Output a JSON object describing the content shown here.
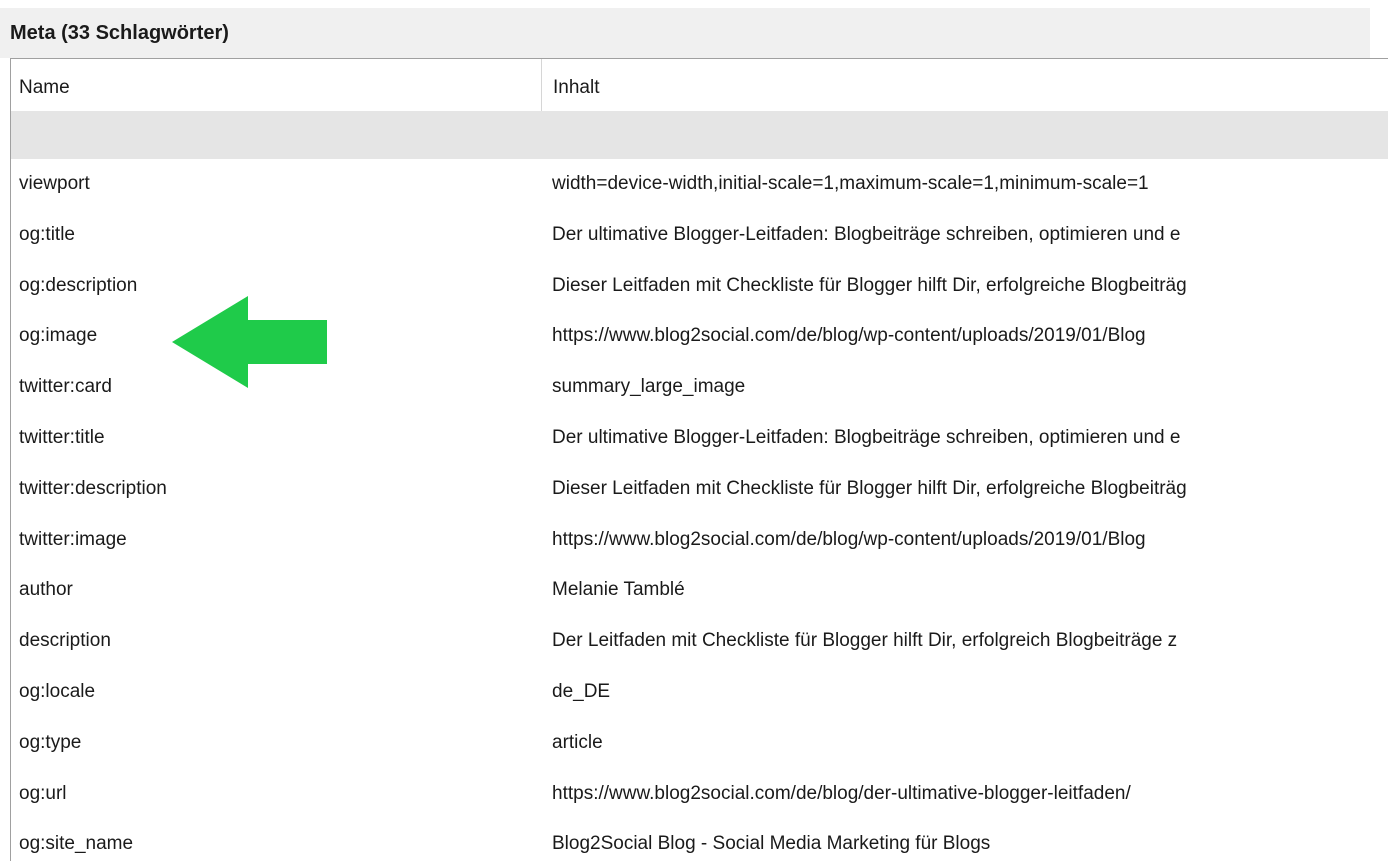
{
  "panel": {
    "title": "Meta (33 Schlagwörter)"
  },
  "table": {
    "columns": [
      "Name",
      "Inhalt"
    ],
    "rows": [
      {
        "name": "viewport",
        "content": "width=device-width,initial-scale=1,maximum-scale=1,minimum-scale=1"
      },
      {
        "name": "og:title",
        "content": "Der ultimative Blogger-Leitfaden: Blogbeiträge schreiben, optimieren und e"
      },
      {
        "name": "og:description",
        "content": "Dieser Leitfaden mit Checkliste für Blogger hilft Dir, erfolgreiche Blogbeiträg"
      },
      {
        "name": "og:image",
        "content": "https://www.blog2social.com/de/blog/wp-content/uploads/2019/01/Blog"
      },
      {
        "name": "twitter:card",
        "content": "summary_large_image"
      },
      {
        "name": "twitter:title",
        "content": "Der ultimative Blogger-Leitfaden: Blogbeiträge schreiben, optimieren und e"
      },
      {
        "name": "twitter:description",
        "content": "Dieser Leitfaden mit Checkliste für Blogger hilft Dir, erfolgreiche Blogbeiträg"
      },
      {
        "name": "twitter:image",
        "content": "https://www.blog2social.com/de/blog/wp-content/uploads/2019/01/Blog"
      },
      {
        "name": "author",
        "content": "Melanie Tamblé"
      },
      {
        "name": "description",
        "content": "Der Leitfaden mit Checkliste für Blogger hilft Dir, erfolgreich Blogbeiträge z"
      },
      {
        "name": "og:locale",
        "content": "de_DE"
      },
      {
        "name": "og:type",
        "content": "article"
      },
      {
        "name": "og:url",
        "content": "https://www.blog2social.com/de/blog/der-ultimative-blogger-leitfaden/"
      },
      {
        "name": "og:site_name",
        "content": "Blog2Social Blog - Social Media Marketing für Blogs"
      }
    ]
  },
  "annotation": {
    "icon": "arrow-left-icon",
    "color": "#1fcb4a"
  }
}
